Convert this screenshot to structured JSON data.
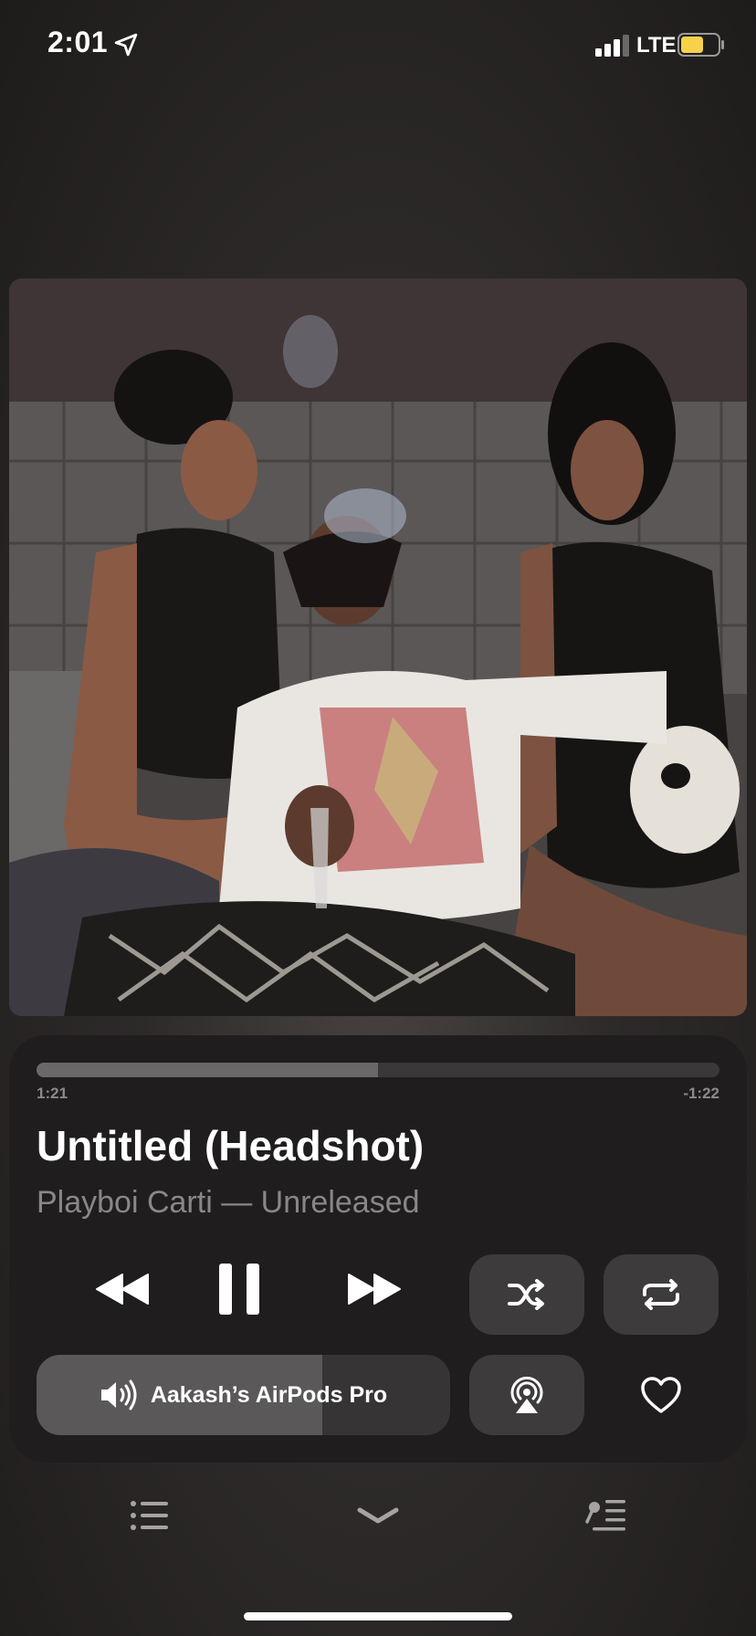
{
  "status_bar": {
    "time": "2:01",
    "network": "LTE",
    "icons": [
      "location-arrow-icon",
      "cellular-signal-icon",
      "battery-icon"
    ],
    "battery_color": "#f5d24a"
  },
  "artwork": {
    "alt": "album-artwork"
  },
  "player": {
    "progress": 0.5,
    "elapsed": "1:21",
    "remaining": "-1:22",
    "song_title": "Untitled (Headshot)",
    "artist_album": "Playboi Carti — Unreleased",
    "volume_level": 0.69,
    "output_device": "Aakash’s AirPods Pro",
    "controls": [
      "rewind-icon",
      "pause-icon",
      "fast-forward-icon",
      "shuffle-icon",
      "repeat-icon",
      "speaker-icon",
      "airplay-icon",
      "heart-icon"
    ]
  },
  "bottom_bar": {
    "icons": [
      "queue-list-icon",
      "chevron-down-icon",
      "lyrics-icon"
    ]
  },
  "colors": {
    "panel": "#1f1d1d",
    "button": "#3d3b3b",
    "secondary_text": "#8a8787"
  }
}
